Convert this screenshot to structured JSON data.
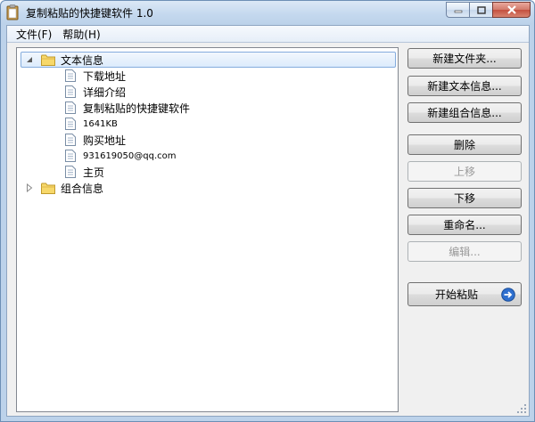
{
  "window": {
    "title": "复制粘贴的快捷键软件 1.0",
    "icon": "clipboard-icon",
    "controls": [
      "minimize-icon",
      "maximize-icon",
      "close-icon"
    ]
  },
  "menu": {
    "file": "文件(F)",
    "help": "帮助(H)"
  },
  "tree": {
    "nodes": [
      {
        "label": "文本信息",
        "expanded": true,
        "selected": true,
        "children": [
          "下载地址",
          "详细介绍",
          "复制粘贴的快捷键软件",
          "1641KB",
          "购买地址",
          "931619050@qq.com",
          "主页"
        ]
      },
      {
        "label": "组合信息",
        "expanded": false,
        "selected": false,
        "children": []
      }
    ]
  },
  "buttons": {
    "new_folder": "新建文件夹...",
    "new_text": "新建文本信息...",
    "new_combo": "新建组合信息...",
    "delete": "删除",
    "move_up": "上移",
    "move_down": "下移",
    "rename": "重命名...",
    "edit": "编辑...",
    "start_paste": "开始粘贴"
  },
  "button_state": {
    "move_up_enabled": false,
    "edit_enabled": false
  }
}
